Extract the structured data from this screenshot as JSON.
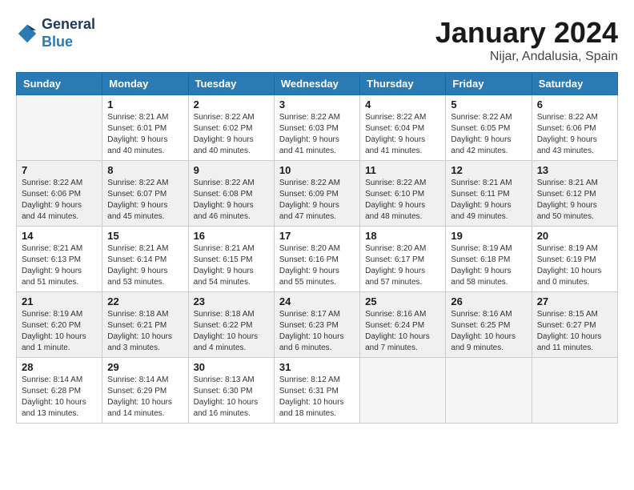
{
  "header": {
    "logo_line1": "General",
    "logo_line2": "Blue",
    "title": "January 2024",
    "subtitle": "Nijar, Andalusia, Spain"
  },
  "days_of_week": [
    "Sunday",
    "Monday",
    "Tuesday",
    "Wednesday",
    "Thursday",
    "Friday",
    "Saturday"
  ],
  "weeks": [
    [
      {
        "day": "",
        "info": ""
      },
      {
        "day": "1",
        "info": "Sunrise: 8:21 AM\nSunset: 6:01 PM\nDaylight: 9 hours\nand 40 minutes."
      },
      {
        "day": "2",
        "info": "Sunrise: 8:22 AM\nSunset: 6:02 PM\nDaylight: 9 hours\nand 40 minutes."
      },
      {
        "day": "3",
        "info": "Sunrise: 8:22 AM\nSunset: 6:03 PM\nDaylight: 9 hours\nand 41 minutes."
      },
      {
        "day": "4",
        "info": "Sunrise: 8:22 AM\nSunset: 6:04 PM\nDaylight: 9 hours\nand 41 minutes."
      },
      {
        "day": "5",
        "info": "Sunrise: 8:22 AM\nSunset: 6:05 PM\nDaylight: 9 hours\nand 42 minutes."
      },
      {
        "day": "6",
        "info": "Sunrise: 8:22 AM\nSunset: 6:06 PM\nDaylight: 9 hours\nand 43 minutes."
      }
    ],
    [
      {
        "day": "7",
        "info": "Sunrise: 8:22 AM\nSunset: 6:06 PM\nDaylight: 9 hours\nand 44 minutes."
      },
      {
        "day": "8",
        "info": "Sunrise: 8:22 AM\nSunset: 6:07 PM\nDaylight: 9 hours\nand 45 minutes."
      },
      {
        "day": "9",
        "info": "Sunrise: 8:22 AM\nSunset: 6:08 PM\nDaylight: 9 hours\nand 46 minutes."
      },
      {
        "day": "10",
        "info": "Sunrise: 8:22 AM\nSunset: 6:09 PM\nDaylight: 9 hours\nand 47 minutes."
      },
      {
        "day": "11",
        "info": "Sunrise: 8:22 AM\nSunset: 6:10 PM\nDaylight: 9 hours\nand 48 minutes."
      },
      {
        "day": "12",
        "info": "Sunrise: 8:21 AM\nSunset: 6:11 PM\nDaylight: 9 hours\nand 49 minutes."
      },
      {
        "day": "13",
        "info": "Sunrise: 8:21 AM\nSunset: 6:12 PM\nDaylight: 9 hours\nand 50 minutes."
      }
    ],
    [
      {
        "day": "14",
        "info": "Sunrise: 8:21 AM\nSunset: 6:13 PM\nDaylight: 9 hours\nand 51 minutes."
      },
      {
        "day": "15",
        "info": "Sunrise: 8:21 AM\nSunset: 6:14 PM\nDaylight: 9 hours\nand 53 minutes."
      },
      {
        "day": "16",
        "info": "Sunrise: 8:21 AM\nSunset: 6:15 PM\nDaylight: 9 hours\nand 54 minutes."
      },
      {
        "day": "17",
        "info": "Sunrise: 8:20 AM\nSunset: 6:16 PM\nDaylight: 9 hours\nand 55 minutes."
      },
      {
        "day": "18",
        "info": "Sunrise: 8:20 AM\nSunset: 6:17 PM\nDaylight: 9 hours\nand 57 minutes."
      },
      {
        "day": "19",
        "info": "Sunrise: 8:19 AM\nSunset: 6:18 PM\nDaylight: 9 hours\nand 58 minutes."
      },
      {
        "day": "20",
        "info": "Sunrise: 8:19 AM\nSunset: 6:19 PM\nDaylight: 10 hours\nand 0 minutes."
      }
    ],
    [
      {
        "day": "21",
        "info": "Sunrise: 8:19 AM\nSunset: 6:20 PM\nDaylight: 10 hours\nand 1 minute."
      },
      {
        "day": "22",
        "info": "Sunrise: 8:18 AM\nSunset: 6:21 PM\nDaylight: 10 hours\nand 3 minutes."
      },
      {
        "day": "23",
        "info": "Sunrise: 8:18 AM\nSunset: 6:22 PM\nDaylight: 10 hours\nand 4 minutes."
      },
      {
        "day": "24",
        "info": "Sunrise: 8:17 AM\nSunset: 6:23 PM\nDaylight: 10 hours\nand 6 minutes."
      },
      {
        "day": "25",
        "info": "Sunrise: 8:16 AM\nSunset: 6:24 PM\nDaylight: 10 hours\nand 7 minutes."
      },
      {
        "day": "26",
        "info": "Sunrise: 8:16 AM\nSunset: 6:25 PM\nDaylight: 10 hours\nand 9 minutes."
      },
      {
        "day": "27",
        "info": "Sunrise: 8:15 AM\nSunset: 6:27 PM\nDaylight: 10 hours\nand 11 minutes."
      }
    ],
    [
      {
        "day": "28",
        "info": "Sunrise: 8:14 AM\nSunset: 6:28 PM\nDaylight: 10 hours\nand 13 minutes."
      },
      {
        "day": "29",
        "info": "Sunrise: 8:14 AM\nSunset: 6:29 PM\nDaylight: 10 hours\nand 14 minutes."
      },
      {
        "day": "30",
        "info": "Sunrise: 8:13 AM\nSunset: 6:30 PM\nDaylight: 10 hours\nand 16 minutes."
      },
      {
        "day": "31",
        "info": "Sunrise: 8:12 AM\nSunset: 6:31 PM\nDaylight: 10 hours\nand 18 minutes."
      },
      {
        "day": "",
        "info": ""
      },
      {
        "day": "",
        "info": ""
      },
      {
        "day": "",
        "info": ""
      }
    ]
  ]
}
